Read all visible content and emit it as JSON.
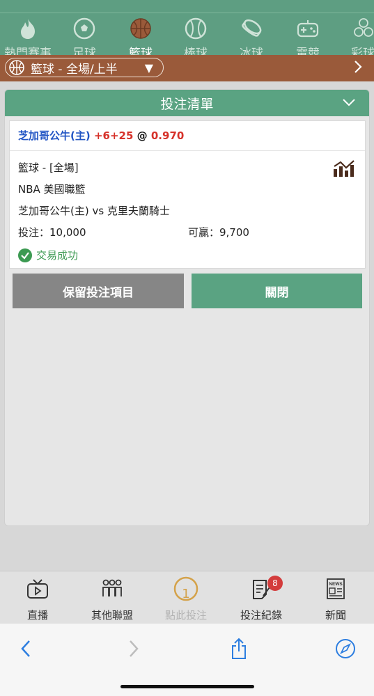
{
  "sports_nav": {
    "items": [
      {
        "label": "熱門賽事",
        "icon": "fire-icon",
        "active": false
      },
      {
        "label": "足球",
        "icon": "soccer-ball-icon",
        "active": false
      },
      {
        "label": "籃球",
        "icon": "basketball-icon",
        "active": true
      },
      {
        "label": "棒球",
        "icon": "baseball-icon",
        "active": false
      },
      {
        "label": "冰球",
        "icon": "hockey-puck-icon",
        "active": false
      },
      {
        "label": "電競",
        "icon": "gamepad-icon",
        "active": false
      },
      {
        "label": "彩球",
        "icon": "lottery-balls-icon",
        "active": false
      }
    ]
  },
  "filter": {
    "label": "籃球 - 全場/上半",
    "arrow": "▼"
  },
  "betslip": {
    "title": "投注清單",
    "selection": {
      "team": "芝加哥公牛(主)",
      "handicap": "+6+25",
      "at": "@",
      "odds": "0.970"
    },
    "market": "籃球 - [全場]",
    "league": "NBA 美國職籃",
    "match": "芝加哥公牛(主) vs 克里夫蘭騎士",
    "stake_label": "投注：10,000",
    "win_label": "可贏：9,700",
    "status": "交易成功",
    "keep_button": "保留投注項目",
    "close_button": "關閉"
  },
  "tabbar": {
    "items": [
      {
        "label": "直播",
        "icon": "tv-icon"
      },
      {
        "label": "其他聯盟",
        "icon": "people-icon"
      },
      {
        "label": "點此投注",
        "icon": "bet-count-icon",
        "count": "1"
      },
      {
        "label": "投注紀錄",
        "icon": "receipt-icon",
        "badge": "8"
      },
      {
        "label": "新聞",
        "icon": "newspaper-icon",
        "news_text": "NEWS"
      }
    ]
  },
  "colors": {
    "header_green": "#5e9e82",
    "filter_brown": "#9a5a3a",
    "accent_green": "#5aa382",
    "odds_red": "#d6322a",
    "team_blue": "#2255c4"
  }
}
